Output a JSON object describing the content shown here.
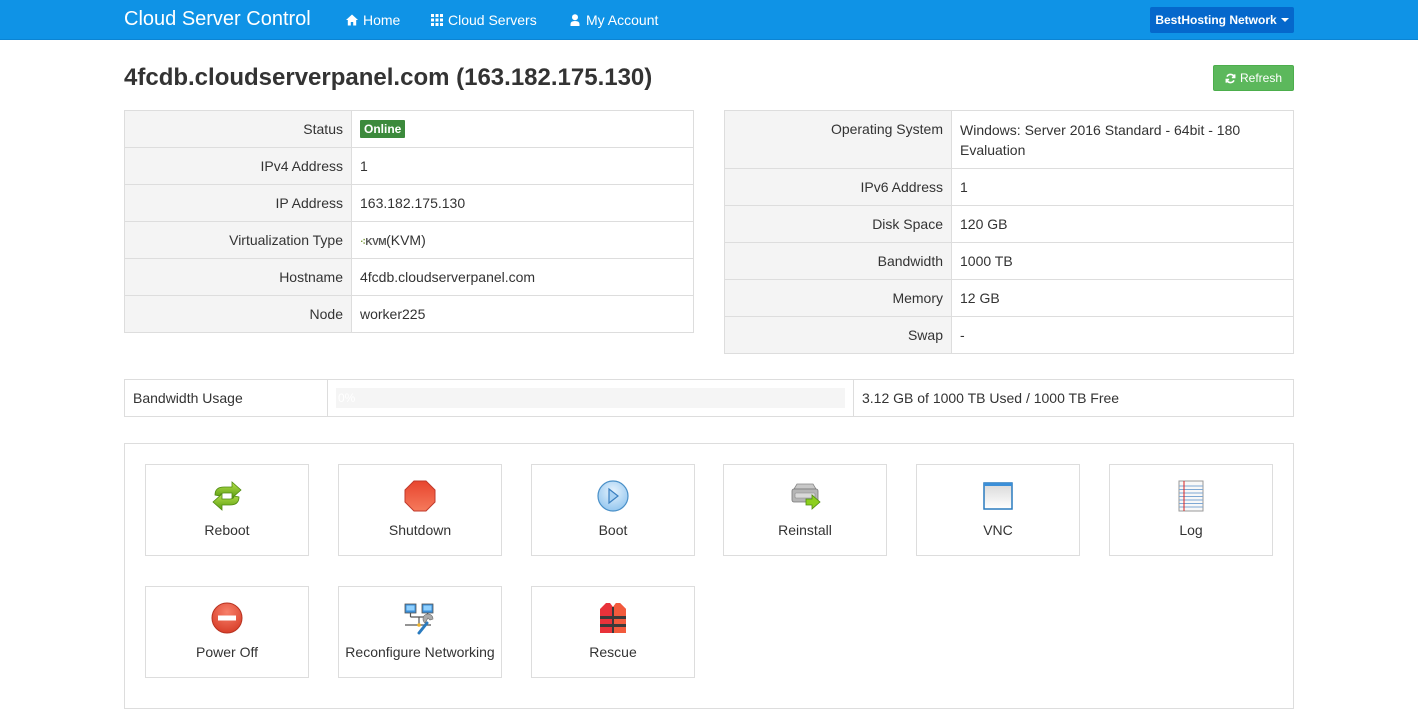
{
  "navbar": {
    "brand": "Cloud Server Control",
    "links": [
      {
        "label": "Home",
        "icon": "home-icon"
      },
      {
        "label": "Cloud Servers",
        "icon": "grid-icon"
      },
      {
        "label": "My Account",
        "icon": "user-icon"
      }
    ],
    "network_dropdown": "BestHosting Network"
  },
  "header": {
    "title": "4fcdb.cloudserverpanel.com (163.182.175.130)",
    "refresh_label": "Refresh"
  },
  "colors": {
    "navbar": "#0f93e6",
    "dropdown": "#0568cc",
    "refresh": "#5cb85c",
    "online_badge": "#3c8a3c"
  },
  "left_table": [
    {
      "label": "Status",
      "value": "Online"
    },
    {
      "label": "IPv4 Address",
      "value": "1"
    },
    {
      "label": "IP Address",
      "value": "163.182.175.130"
    },
    {
      "label": "Virtualization Type",
      "logo": "KVM",
      "value": "(KVM)"
    },
    {
      "label": "Hostname",
      "value": "4fcdb.cloudserverpanel.com"
    },
    {
      "label": "Node",
      "value": "worker225"
    }
  ],
  "right_table": [
    {
      "label": "Operating System",
      "value": "Windows: Server 2016 Standard - 64bit - 180 Evaluation"
    },
    {
      "label": "IPv6 Address",
      "value": "1"
    },
    {
      "label": "Disk Space",
      "value": "120 GB"
    },
    {
      "label": "Bandwidth",
      "value": "1000 TB"
    },
    {
      "label": "Memory",
      "value": "12 GB"
    },
    {
      "label": "Swap",
      "value": "-"
    }
  ],
  "bandwidth": {
    "label": "Bandwidth Usage",
    "percent_label": "0%",
    "percent": 0,
    "summary": "3.12 GB of 1000 TB Used / 1000 TB Free"
  },
  "actions": [
    {
      "label": "Reboot",
      "icon": "reboot-icon"
    },
    {
      "label": "Shutdown",
      "icon": "shutdown-icon"
    },
    {
      "label": "Boot",
      "icon": "boot-icon"
    },
    {
      "label": "Reinstall",
      "icon": "reinstall-icon"
    },
    {
      "label": "VNC",
      "icon": "vnc-icon"
    },
    {
      "label": "Log",
      "icon": "log-icon"
    },
    {
      "label": "Power Off",
      "icon": "power-off-icon"
    },
    {
      "label": "Reconfigure Networking",
      "icon": "network-icon"
    },
    {
      "label": "Rescue",
      "icon": "rescue-icon"
    }
  ]
}
